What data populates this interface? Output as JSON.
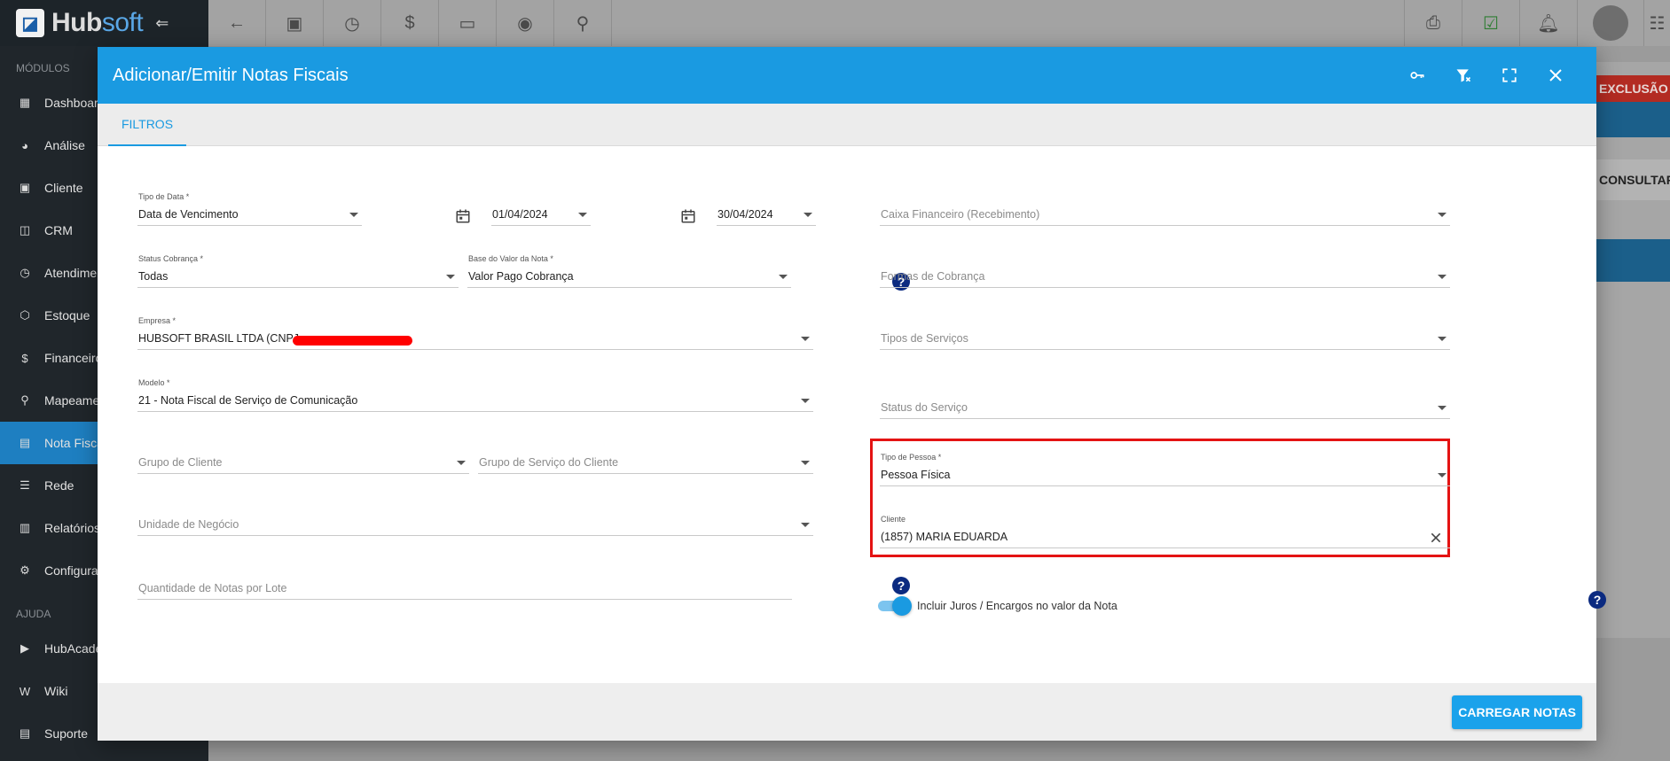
{
  "app": {
    "logo_prefix": "Hub",
    "logo_suffix": "soft",
    "collapse_icon": "collapse-arrow-icon"
  },
  "sidebar": {
    "section_modules": "MÓDULOS",
    "section_help": "AJUDA",
    "items": [
      {
        "label": "Dashboard",
        "icon": "dashboard-icon"
      },
      {
        "label": "Análise",
        "icon": "pie-chart-icon"
      },
      {
        "label": "Cliente",
        "icon": "contact-icon"
      },
      {
        "label": "CRM",
        "icon": "crm-icon"
      },
      {
        "label": "Atendimento",
        "icon": "calendar-clock-icon"
      },
      {
        "label": "Estoque",
        "icon": "box-icon"
      },
      {
        "label": "Financeiro",
        "icon": "money-icon"
      },
      {
        "label": "Mapeamento",
        "icon": "map-pin-icon"
      },
      {
        "label": "Nota Fiscal",
        "icon": "document-icon"
      },
      {
        "label": "Rede",
        "icon": "network-icon"
      },
      {
        "label": "Relatórios",
        "icon": "report-icon"
      },
      {
        "label": "Configurações",
        "icon": "gear-icon"
      }
    ],
    "help_items": [
      {
        "label": "HubAcademy",
        "icon": "youtube-icon"
      },
      {
        "label": "Wiki",
        "icon": "wikipedia-icon"
      },
      {
        "label": "Suporte",
        "icon": "chat-icon"
      }
    ]
  },
  "background": {
    "exclusao_label": "EXCLUSÃO",
    "consultar_label": "CONSULTAR"
  },
  "modal": {
    "title": "Adicionar/Emitir Notas Fiscais",
    "tab_label": "FILTROS",
    "submit_label": "CARREGAR NOTAS",
    "fields": {
      "tipo_data": {
        "label": "Tipo de Data *",
        "value": "Data de Vencimento"
      },
      "data_inicio": {
        "value": "01/04/2024"
      },
      "data_fim": {
        "value": "30/04/2024"
      },
      "caixa": {
        "placeholder": "Caixa Financeiro (Recebimento)"
      },
      "status_cobranca": {
        "label": "Status Cobrança *",
        "value": "Todas"
      },
      "base_valor": {
        "label": "Base do Valor da Nota *",
        "value": "Valor Pago Cobrança"
      },
      "formas_cobranca": {
        "placeholder": "Formas de Cobrança"
      },
      "empresa": {
        "label": "Empresa *",
        "value": "HUBSOFT BRASIL LTDA (CNPJ"
      },
      "tipos_servicos": {
        "placeholder": "Tipos de Serviços"
      },
      "modelo": {
        "label": "Modelo *",
        "value": "21 - Nota Fiscal de Serviço de Comunicação"
      },
      "status_servico": {
        "placeholder": "Status do Serviço"
      },
      "grupo_cliente": {
        "placeholder": "Grupo de Cliente"
      },
      "grupo_servico": {
        "placeholder": "Grupo de Serviço do Cliente"
      },
      "tipo_pessoa": {
        "label": "Tipo de Pessoa *",
        "value": "Pessoa Física"
      },
      "cliente": {
        "label": "Cliente",
        "value": "(1857) MARIA EDUARDA"
      },
      "unidade_negocio": {
        "placeholder": "Unidade de Negócio"
      },
      "qtd_notas": {
        "placeholder": "Quantidade de Notas por Lote"
      },
      "juros_toggle": {
        "label": "Incluir Juros / Encargos no valor da Nota",
        "on": true
      }
    }
  },
  "colors": {
    "accent": "#1a9ae1",
    "highlight": "#e41313",
    "help_icon": "#0b2a80"
  }
}
